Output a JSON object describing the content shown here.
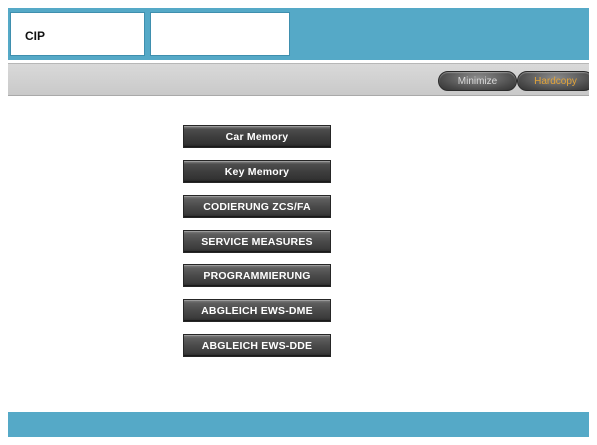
{
  "window": {
    "title": "CIP",
    "title_secondary": ""
  },
  "toolbar": {
    "minimize_label": "Minimize",
    "hardcopy_label": "Hardcopy"
  },
  "menu": {
    "items": [
      {
        "label": "Car Memory"
      },
      {
        "label": "Key Memory"
      },
      {
        "label": "CODIERUNG ZCS/FA"
      },
      {
        "label": "SERVICE MEASURES"
      },
      {
        "label": "PROGRAMMIERUNG"
      },
      {
        "label": "ABGLEICH EWS-DME"
      },
      {
        "label": "ABGLEICH EWS-DDE"
      }
    ]
  },
  "colors": {
    "accent_blue": "#55a9c7",
    "toolbar_gray": "#cfcfcf",
    "button_dark": "#3e3e3e",
    "hardcopy_text": "#e2a43a"
  }
}
